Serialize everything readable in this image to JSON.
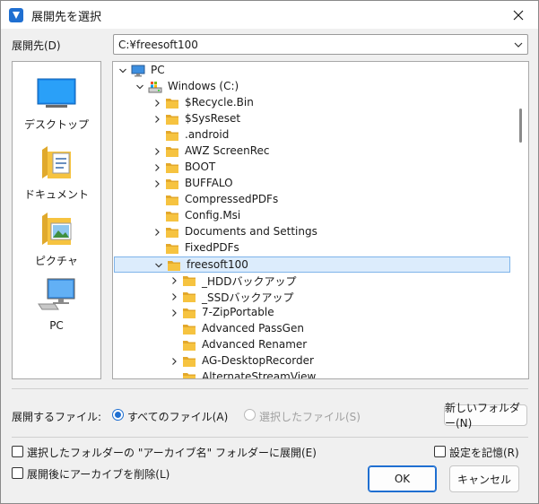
{
  "window": {
    "title": "展開先を選択"
  },
  "dest": {
    "label": "展開先(D)",
    "value": "C:¥freesoft100"
  },
  "places": [
    {
      "label": "デスクトップ",
      "icon": "desktop-icon"
    },
    {
      "label": "ドキュメント",
      "icon": "documents-folder-icon"
    },
    {
      "label": "ピクチャ",
      "icon": "pictures-folder-icon"
    },
    {
      "label": "PC",
      "icon": "computer-icon"
    }
  ],
  "tree": [
    {
      "label": "PC",
      "icon": "computer-icon"
    },
    {
      "label": "Windows (C:)",
      "icon": "drive-icon"
    },
    {
      "label": "$Recycle.Bin",
      "icon": "folder-icon"
    },
    {
      "label": "$SysReset",
      "icon": "folder-icon"
    },
    {
      "label": ".android",
      "icon": "folder-icon"
    },
    {
      "label": "AWZ ScreenRec",
      "icon": "folder-icon"
    },
    {
      "label": "BOOT",
      "icon": "folder-icon"
    },
    {
      "label": "BUFFALO",
      "icon": "folder-icon"
    },
    {
      "label": "CompressedPDFs",
      "icon": "folder-icon"
    },
    {
      "label": "Config.Msi",
      "icon": "folder-icon"
    },
    {
      "label": "Documents and Settings",
      "icon": "folder-icon"
    },
    {
      "label": "FixedPDFs",
      "icon": "folder-icon"
    },
    {
      "label": "freesoft100",
      "icon": "folder-icon"
    },
    {
      "label": "_HDDバックアップ",
      "icon": "folder-icon"
    },
    {
      "label": "_SSDバックアップ",
      "icon": "folder-icon"
    },
    {
      "label": "7-ZipPortable",
      "icon": "folder-icon"
    },
    {
      "label": "Advanced PassGen",
      "icon": "folder-icon"
    },
    {
      "label": "Advanced Renamer",
      "icon": "folder-icon"
    },
    {
      "label": "AG-DesktopRecorder",
      "icon": "folder-icon"
    },
    {
      "label": "AlternateStreamView",
      "icon": "folder-icon"
    }
  ],
  "files": {
    "label": "展開するファイル:",
    "all_label": "すべてのファイル(A)",
    "selected_label": "選択したファイル(S)",
    "new_folder_label": "新しいフォルダー(N)"
  },
  "options": {
    "archive_folder_label": "選択したフォルダーの \"アーカイブ名\" フォルダーに展開(E)",
    "delete_after_label": "展開後にアーカイブを削除(L)",
    "remember_label": "設定を記憶(R)"
  },
  "buttons": {
    "ok": "OK",
    "cancel": "キャンセル"
  },
  "colors": {
    "accent": "#1f6fd1",
    "folder": "#f6c340",
    "selection": "#dcecfc"
  }
}
